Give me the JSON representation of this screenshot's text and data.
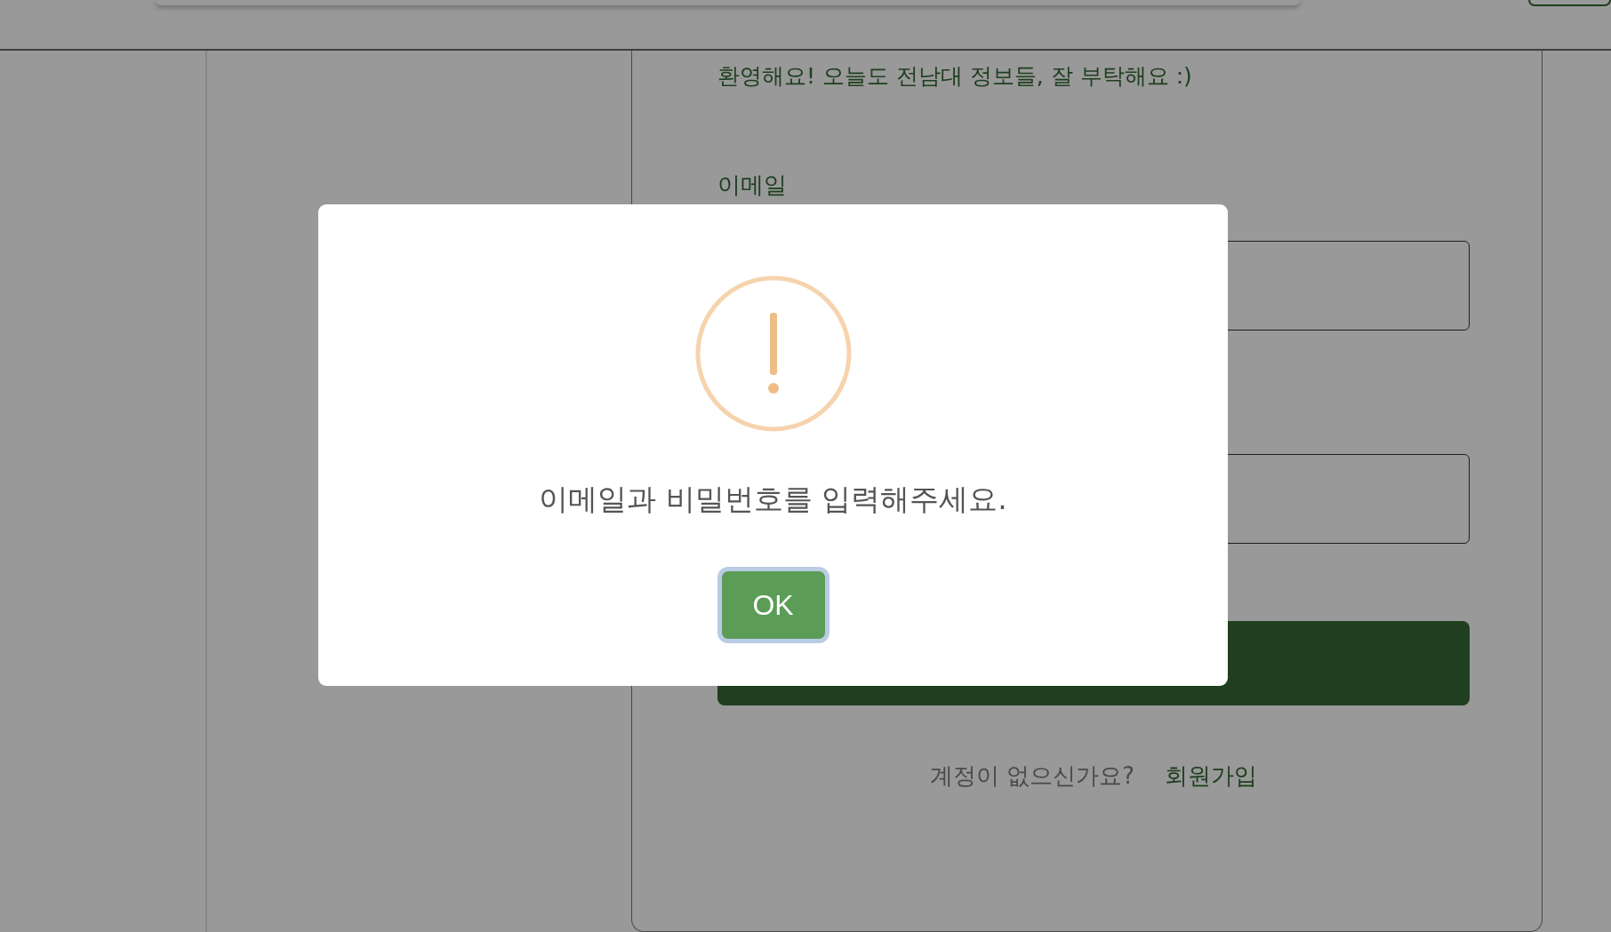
{
  "welcome": "환영해요! 오늘도 전남대 정보들, 잘 부탁해요 :)",
  "login_form": {
    "email_label": "이메일"
  },
  "signup": {
    "prompt": "계정이 없으신가요?",
    "link": "회원가입"
  },
  "alert": {
    "kind": "warning",
    "message": "이메일과 비밀번호를 입력해주세요.",
    "button": "OK"
  }
}
